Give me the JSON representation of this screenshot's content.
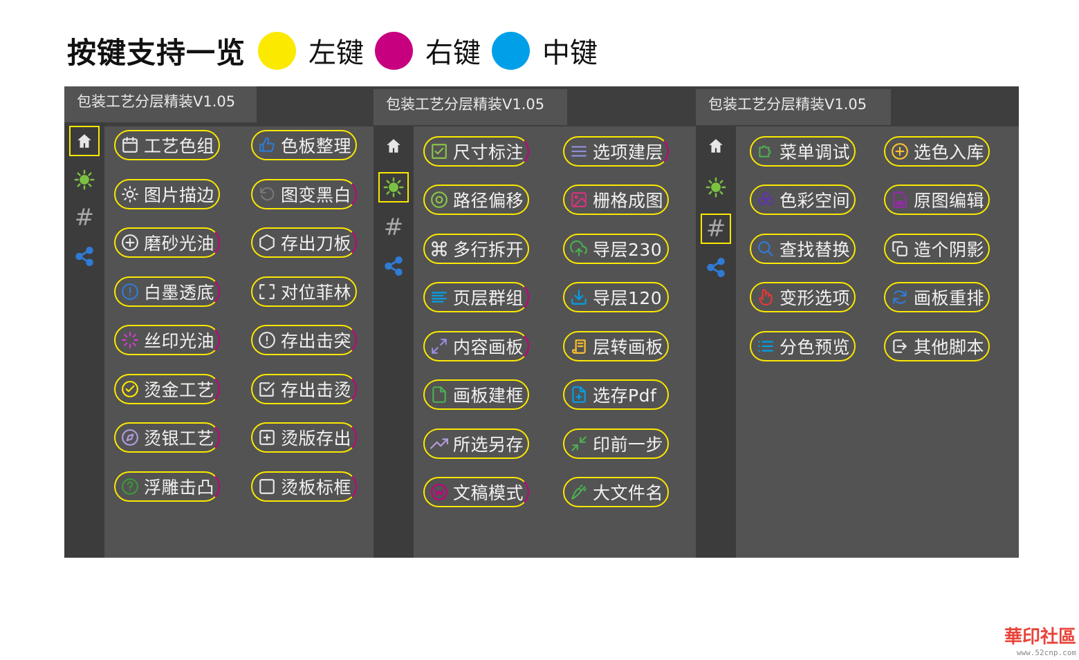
{
  "legend": {
    "title": "按键支持一览",
    "items": [
      {
        "label": "左键",
        "color": "#fbe900"
      },
      {
        "label": "右键",
        "color": "#c6007e"
      },
      {
        "label": "中键",
        "color": "#00a0e9"
      }
    ]
  },
  "colors": {
    "panel_bg": "#535353",
    "tabbar_bg": "#3e3e3e",
    "sidebar_bg": "#3c3c3c",
    "left_click": "#fbe900",
    "right_click": "#c6007e",
    "middle_click": "#00a0e9"
  },
  "panels": [
    {
      "tab_title": "包装工艺分层精装V1.05",
      "active_sidebar": "home",
      "buttons": [
        {
          "label": "工艺色组",
          "icon": "calendar-icon",
          "icon_color": "#e8e8e8"
        },
        {
          "label": "色板整理",
          "icon": "thumbs-up-icon",
          "icon_color": "#2f7bd6"
        },
        {
          "label": "图片描边",
          "icon": "sun-outline-icon",
          "icon_color": "#e8e8e8"
        },
        {
          "label": "图变黑白",
          "icon": "rotate-icon",
          "icon_color": "#777777"
        },
        {
          "label": "磨砂光油",
          "icon": "plus-circle-icon",
          "icon_color": "#e8e8e8"
        },
        {
          "label": "存出刀板",
          "icon": "hexagon-icon",
          "icon_color": "#e8e8e8"
        },
        {
          "label": "白墨透底",
          "icon": "info-circle-icon",
          "icon_color": "#2f7bd6"
        },
        {
          "label": "对位菲林",
          "icon": "corners-icon",
          "icon_color": "#e8e8e8"
        },
        {
          "label": "丝印光油",
          "icon": "loader-icon",
          "icon_color": "#d13ec9"
        },
        {
          "label": "存出击突",
          "icon": "alert-circle-icon",
          "icon_color": "#e8e8e8"
        },
        {
          "label": "烫金工艺",
          "icon": "check-circle-icon",
          "icon_color": "#fbe900"
        },
        {
          "label": "存出击烫",
          "icon": "check-square-icon",
          "icon_color": "#e8e8e8"
        },
        {
          "label": "烫银工艺",
          "icon": "compass-icon",
          "icon_color": "#b09be0"
        },
        {
          "label": "烫版存出",
          "icon": "plus-square-icon",
          "icon_color": "#e8e8e8"
        },
        {
          "label": "浮雕击凸",
          "icon": "help-circle-icon",
          "icon_color": "#3a9a3a"
        },
        {
          "label": "烫板标框",
          "icon": "square-icon",
          "icon_color": "#e8e8e8"
        }
      ]
    },
    {
      "tab_title": "包装工艺分层精装V1.05",
      "active_sidebar": "sun",
      "buttons": [
        {
          "label": "尺寸标注",
          "icon": "checkbox-icon",
          "icon_color": "#8bc34a"
        },
        {
          "label": "选项建层",
          "icon": "menu-icon",
          "icon_color": "#8e8edc"
        },
        {
          "label": "路径偏移",
          "icon": "target-icon",
          "icon_color": "#8bc34a"
        },
        {
          "label": "栅格成图",
          "icon": "image-icon",
          "icon_color": "#d6337f"
        },
        {
          "label": "多行拆开",
          "icon": "command-icon",
          "icon_color": "#e8e8e8"
        },
        {
          "label": "导层230",
          "icon": "upload-cloud-icon",
          "icon_color": "#4caf50"
        },
        {
          "label": "页层群组",
          "icon": "align-left-icon",
          "icon_color": "#00a0e9"
        },
        {
          "label": "导层120",
          "icon": "download-icon",
          "icon_color": "#00a0e9"
        },
        {
          "label": "内容画板",
          "icon": "maximize-icon",
          "icon_color": "#9b8de0"
        },
        {
          "label": "层转画板",
          "icon": "scroll-icon",
          "icon_color": "#fbc02d"
        },
        {
          "label": "画板建框",
          "icon": "file-icon",
          "icon_color": "#4caf50"
        },
        {
          "label": "选存Pdf",
          "icon": "file-plus-icon",
          "icon_color": "#00a0e9"
        },
        {
          "label": "所选另存",
          "icon": "trending-icon",
          "icon_color": "#b39ddb"
        },
        {
          "label": "印前一步",
          "icon": "minimize-icon",
          "icon_color": "#4caf50"
        },
        {
          "label": "文稿模式",
          "icon": "badge-icon",
          "icon_color": "#c6007e"
        },
        {
          "label": "大文件名",
          "icon": "carrot-icon",
          "icon_color": "#4caf50"
        }
      ]
    },
    {
      "tab_title": "包装工艺分层精装V1.05",
      "active_sidebar": "hash",
      "buttons": [
        {
          "label": "菜单调试",
          "icon": "puzzle-icon",
          "icon_color": "#4caf50"
        },
        {
          "label": "选色入库",
          "icon": "plus-circle-icon",
          "icon_color": "#fbc02d"
        },
        {
          "label": "色彩空间",
          "icon": "clover-icon",
          "icon_color": "#5e35b1"
        },
        {
          "label": "原图编辑",
          "icon": "image-file-icon",
          "icon_color": "#9c27b0"
        },
        {
          "label": "查找替换",
          "icon": "search-icon",
          "icon_color": "#2f7bd6"
        },
        {
          "label": "造个阴影",
          "icon": "copy-icon",
          "icon_color": "#e8e8e8"
        },
        {
          "label": "变形选项",
          "icon": "hand-icon",
          "icon_color": "#e53935"
        },
        {
          "label": "画板重排",
          "icon": "refresh-icon",
          "icon_color": "#2f7bd6"
        },
        {
          "label": "分色预览",
          "icon": "list-icon",
          "icon_color": "#00a0e9"
        },
        {
          "label": "其他脚本",
          "icon": "logout-icon",
          "icon_color": "#e8e8e8"
        }
      ]
    }
  ],
  "watermark": {
    "logo": "華印社區",
    "url": "www.52cnp.com"
  }
}
